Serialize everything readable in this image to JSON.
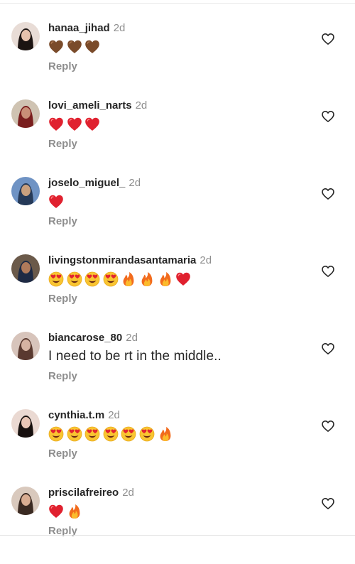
{
  "comments": [
    {
      "username": "hanaa_jihad",
      "time": "2d",
      "emojis": [
        "brown-heart",
        "brown-heart",
        "brown-heart"
      ],
      "text": "",
      "reply_label": "Reply",
      "avatar": {
        "bg": "#e8dcd6",
        "hair": "#1c1412",
        "skin": "#e7c2ad"
      }
    },
    {
      "username": "lovi_ameli_narts",
      "time": "2d",
      "emojis": [
        "red-heart",
        "red-heart",
        "red-heart"
      ],
      "text": "",
      "reply_label": "Reply",
      "avatar": {
        "bg": "#cfc3b2",
        "hair": "#7a1e1e",
        "skin": "#c98f77"
      }
    },
    {
      "username": "joselo_miguel_",
      "time": "2d",
      "emojis": [
        "red-heart"
      ],
      "text": "",
      "reply_label": "Reply",
      "avatar": {
        "bg": "#6f93c4",
        "hair": "#263a58",
        "skin": "#c9a07e"
      }
    },
    {
      "username": "livingstonmirandasantamaria",
      "time": "2d",
      "emojis": [
        "heart-eyes",
        "heart-eyes",
        "heart-eyes",
        "heart-eyes",
        "fire",
        "fire",
        "fire",
        "red-heart"
      ],
      "text": "",
      "reply_label": "Reply",
      "avatar": {
        "bg": "#6b5a4a",
        "hair": "#1e2a44",
        "skin": "#b07a5a"
      }
    },
    {
      "username": "biancarose_80",
      "time": "2d",
      "emojis": [],
      "text": "I need to be rt in the middle..",
      "reply_label": "Reply",
      "avatar": {
        "bg": "#d7c4bb",
        "hair": "#5a3a30",
        "skin": "#d6b3a2"
      }
    },
    {
      "username": "cynthia.t.m",
      "time": "2d",
      "emojis": [
        "heart-eyes",
        "heart-eyes",
        "heart-eyes",
        "heart-eyes",
        "heart-eyes",
        "heart-eyes",
        "fire"
      ],
      "text": "",
      "reply_label": "Reply",
      "avatar": {
        "bg": "#ead9d2",
        "hair": "#17110f",
        "skin": "#e9c6b6"
      }
    },
    {
      "username": "priscilafreireo",
      "time": "2d",
      "emojis": [
        "red-heart",
        "fire"
      ],
      "text": "",
      "reply_label": "Reply",
      "avatar": {
        "bg": "#d9c9bd",
        "hair": "#3b2a22",
        "skin": "#d9ad92"
      }
    }
  ],
  "colors": {
    "username": "#262626",
    "secondary": "#8e8e8e",
    "like_icon": "#262626"
  }
}
